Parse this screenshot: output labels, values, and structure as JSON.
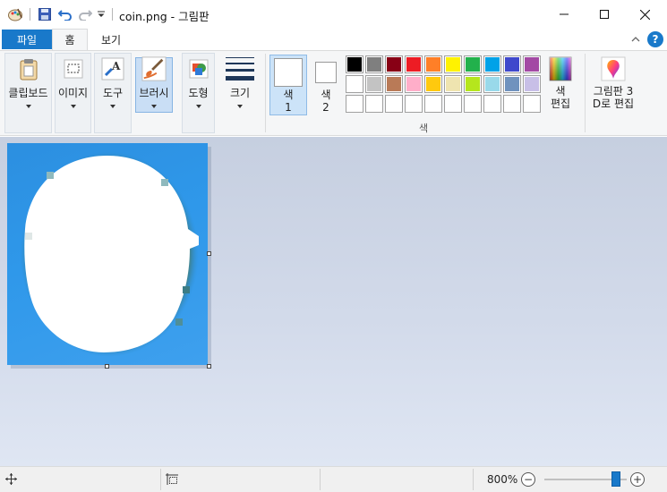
{
  "window": {
    "title": "coin.png - 그림판",
    "controls": {
      "minimize": "minimize-icon",
      "maximize": "maximize-icon",
      "close": "close-icon"
    }
  },
  "quick_access": [
    "paint-app-icon",
    "save-icon",
    "undo-icon",
    "redo-icon",
    "customize-dropdown-icon"
  ],
  "tabs": {
    "file": "파일",
    "home": "홈",
    "view": "보기"
  },
  "help_label": "?",
  "ribbon": {
    "clipboard": "클립보드",
    "image": "이미지",
    "tools": "도구",
    "brushes": "브러시",
    "shapes": "도형",
    "size": "크기",
    "color1_line1": "색",
    "color1_line2": "1",
    "color2_line1": "색",
    "color2_line2": "2",
    "edit_colors_line1": "색",
    "edit_colors_line2": "편집",
    "paint3d_line1": "그림판 3",
    "paint3d_line2": "D로 편집",
    "colors_caption": "색"
  },
  "palette": {
    "row1": [
      "#000000",
      "#7f7f7f",
      "#880015",
      "#ed1c24",
      "#ff7f27",
      "#fff200",
      "#22b14c",
      "#00a2e8",
      "#3f48cc",
      "#a349a4"
    ],
    "row2": [
      "#ffffff",
      "#c3c3c3",
      "#b97a57",
      "#ffaec9",
      "#ffc90e",
      "#efe4b0",
      "#b5e61d",
      "#99d9ea",
      "#7092be",
      "#c8bfe7"
    ],
    "row3": [
      "",
      "",
      "",
      "",
      "",
      "",
      "",
      "",
      "",
      ""
    ]
  },
  "colors": {
    "accent": "#1979ca",
    "color1": "#ffffff",
    "color2": "#ffffff"
  },
  "status": {
    "zoom": "800%",
    "zoom_out": "−",
    "zoom_in": "+",
    "zoom_level_fraction": 0.87
  }
}
